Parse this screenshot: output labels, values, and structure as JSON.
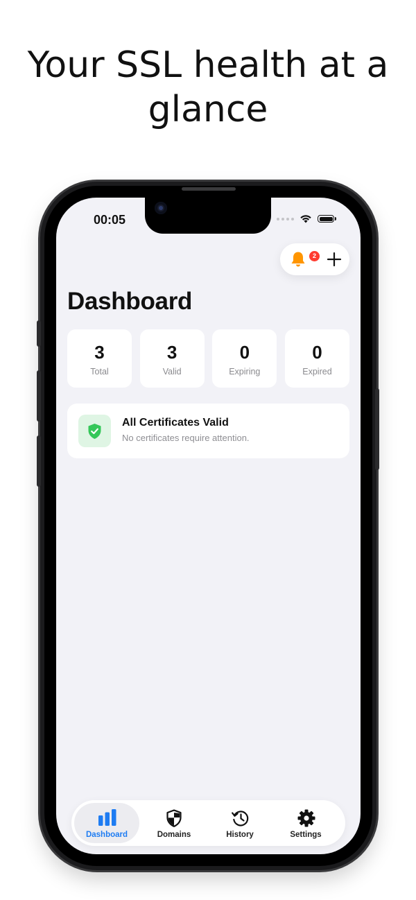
{
  "headline": {
    "line1": "Your SSL health at a",
    "line2": "glance"
  },
  "status_bar": {
    "time": "00:05"
  },
  "toolbar": {
    "notification_count": "2",
    "bell_icon": "bell-icon",
    "add_icon": "plus-icon"
  },
  "dashboard": {
    "title": "Dashboard",
    "stats": [
      {
        "value": "3",
        "label": "Total"
      },
      {
        "value": "3",
        "label": "Valid"
      },
      {
        "value": "0",
        "label": "Expiring"
      },
      {
        "value": "0",
        "label": "Expired"
      }
    ],
    "status_card": {
      "title": "All Certificates Valid",
      "subtitle": "No certificates require attention.",
      "icon": "shield-check-icon"
    }
  },
  "tab_bar": {
    "tabs": [
      {
        "label": "Dashboard",
        "icon": "bar-chart-icon",
        "active": true
      },
      {
        "label": "Domains",
        "icon": "shield-icon",
        "active": false
      },
      {
        "label": "History",
        "icon": "history-clock-icon",
        "active": false
      },
      {
        "label": "Settings",
        "icon": "gear-icon",
        "active": false
      }
    ]
  },
  "colors": {
    "accent": "#1e7cf2",
    "bell": "#ff9500",
    "badge": "#ff3b30",
    "success": "#34c759",
    "success_bg": "#dff5e4",
    "background": "#f2f2f7"
  }
}
